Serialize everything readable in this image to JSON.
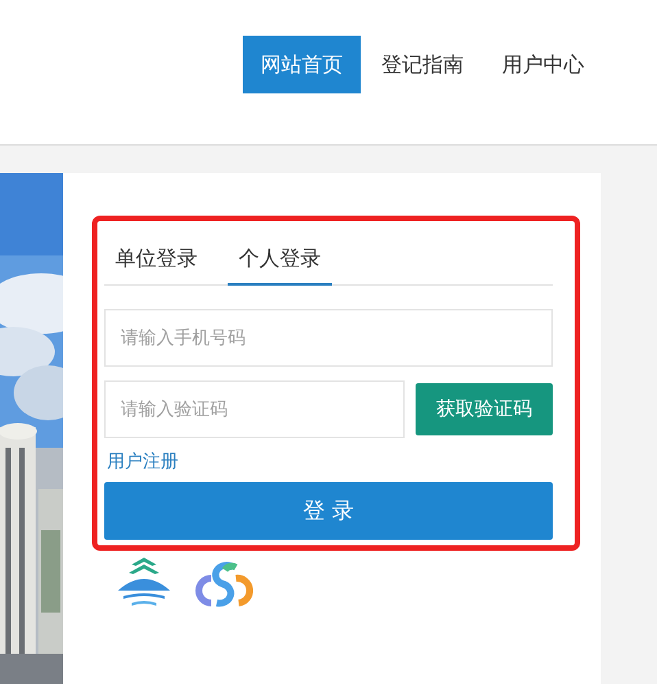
{
  "nav": [
    {
      "label": "网站首页",
      "selected": true
    },
    {
      "label": "登记指南",
      "selected": false
    },
    {
      "label": "用户中心",
      "selected": false
    }
  ],
  "login": {
    "tabs": [
      {
        "label": "单位登录",
        "selected": false
      },
      {
        "label": "个人登录",
        "selected": true
      }
    ],
    "phone_field": {
      "placeholder": "请输入手机号码"
    },
    "code_field": {
      "placeholder": "请输入验证码"
    },
    "code_button": "获取验证码",
    "register_link": "用户注册",
    "login_button": "登 录"
  }
}
